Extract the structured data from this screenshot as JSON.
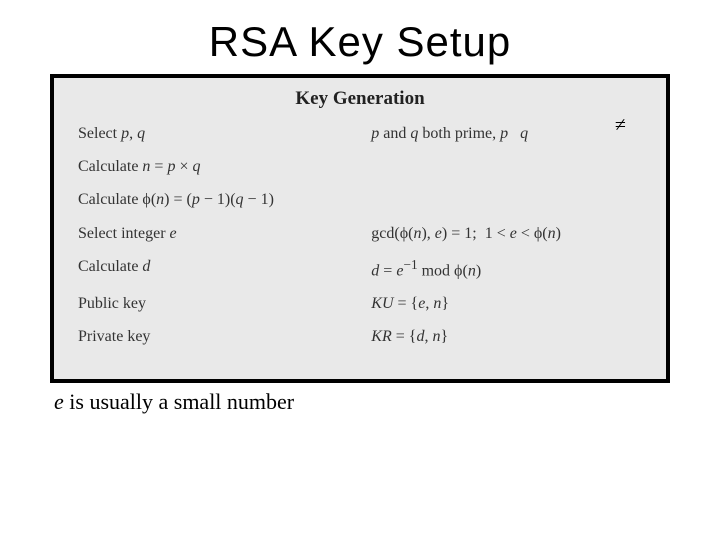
{
  "title": "RSA Key Setup",
  "box": {
    "heading": "Key Generation",
    "rows": [
      {
        "left_html": "Select <i>p</i>, <i>q</i>",
        "right_html": "<i>p</i> and <i>q</i> both prime, <i>p</i>&nbsp;&nbsp;&nbsp;<i>q</i>"
      },
      {
        "left_html": "Calculate <i>n</i> = <i>p</i> × <i>q</i>",
        "right_html": ""
      },
      {
        "left_html": "Calculate ϕ(<i>n</i>) = (<i>p</i> − 1)(<i>q</i> − 1)",
        "right_html": ""
      },
      {
        "left_html": "Select integer <i>e</i>",
        "right_html": "gcd(ϕ(<i>n</i>), <i>e</i>) = 1;&nbsp;&nbsp;1 &lt; <i>e</i> &lt; ϕ(<i>n</i>)"
      },
      {
        "left_html": "Calculate <i>d</i>",
        "right_html": "<i>d</i> = <i>e</i><sup>−1</sup> mod ϕ(<i>n</i>)"
      },
      {
        "left_html": "Public key",
        "right_html": "<i>KU</i> = {<i>e</i>, <i>n</i>}"
      },
      {
        "left_html": "Private key",
        "right_html": "<i>KR</i> = {<i>d</i>, <i>n</i>}"
      }
    ],
    "neq_symbol": "≠"
  },
  "footnote_html": "<span class=\"e\">e</span> is usually a small number"
}
